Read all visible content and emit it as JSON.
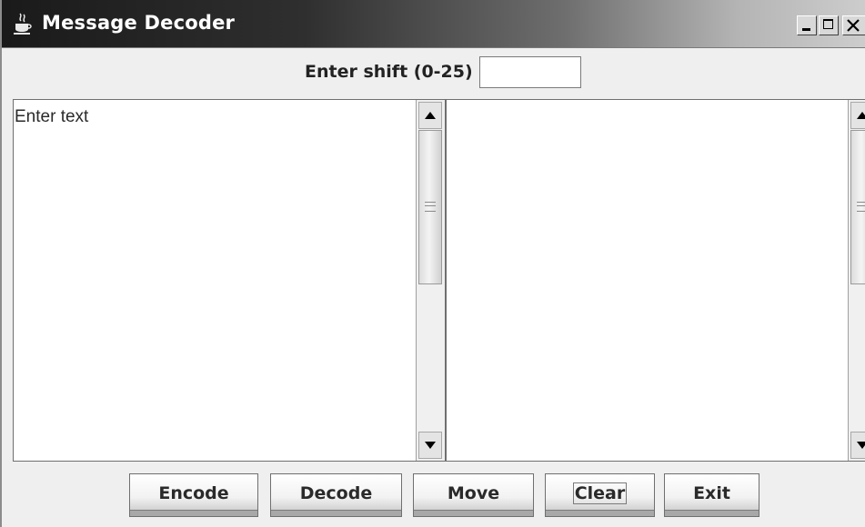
{
  "window": {
    "title": "Message Decoder",
    "controls": [
      "minimize-icon",
      "maximize-icon",
      "close-icon"
    ]
  },
  "shift": {
    "label": "Enter shift (0-25)",
    "value": ""
  },
  "input_pane": {
    "text": "Enter text"
  },
  "output_pane": {
    "text": ""
  },
  "buttons": {
    "encode": "Encode",
    "decode": "Decode",
    "move": "Move",
    "clear": "Clear",
    "exit": "Exit"
  },
  "focused_button": "Clear",
  "colors": {
    "window_bg": "#efefef",
    "titlebar_dark": "#1a1a1a",
    "titlebar_light": "#cdcdcd"
  }
}
